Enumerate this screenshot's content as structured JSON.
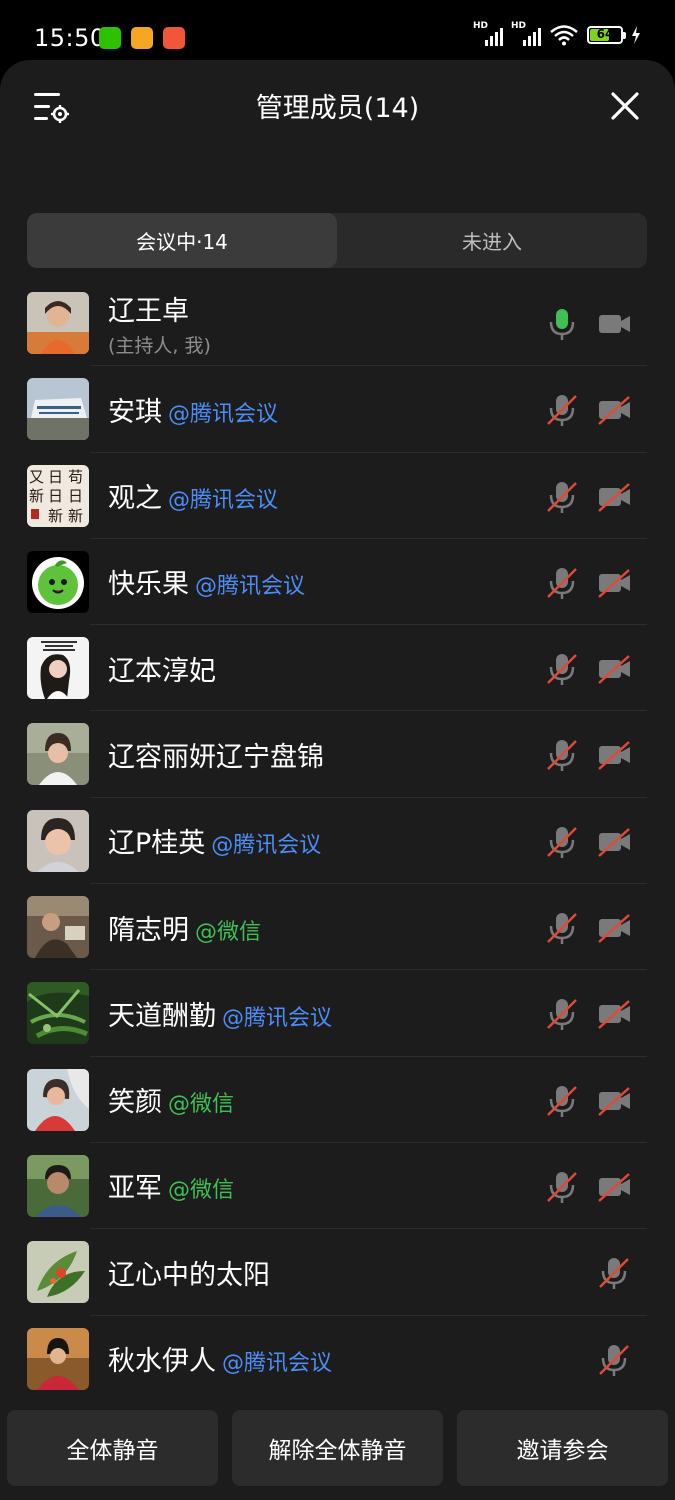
{
  "status_bar": {
    "time": "15:50",
    "battery_level": "64",
    "signal_label": "HD",
    "app_icon_colors": [
      "#2dc100",
      "#f5a623",
      "#f0563a"
    ]
  },
  "header": {
    "title": "管理成员(14)"
  },
  "tabs": [
    {
      "label": "会议中·14",
      "active": true
    },
    {
      "label": "未进入",
      "active": false
    }
  ],
  "members": [
    {
      "name": "辽王卓",
      "tag": "",
      "tag_type": "",
      "subtitle": "(主持人, 我)",
      "mic": "on",
      "camera": "off"
    },
    {
      "name": "安琪",
      "tag": "@腾讯会议",
      "tag_type": "tencent",
      "mic": "muted",
      "camera": "disabled"
    },
    {
      "name": "观之",
      "tag": "@腾讯会议",
      "tag_type": "tencent",
      "mic": "muted",
      "camera": "disabled"
    },
    {
      "name": "快乐果",
      "tag": "@腾讯会议",
      "tag_type": "tencent",
      "mic": "muted",
      "camera": "disabled"
    },
    {
      "name": "辽本淳妃",
      "tag": "",
      "tag_type": "",
      "mic": "muted",
      "camera": "disabled"
    },
    {
      "name": "辽容丽妍辽宁盘锦",
      "tag": "",
      "tag_type": "",
      "mic": "muted",
      "camera": "disabled"
    },
    {
      "name": "辽P桂英",
      "tag": "@腾讯会议",
      "tag_type": "tencent",
      "mic": "muted",
      "camera": "disabled"
    },
    {
      "name": "隋志明",
      "tag": "@微信",
      "tag_type": "wechat",
      "mic": "muted",
      "camera": "disabled"
    },
    {
      "name": "天道酬勤",
      "tag": "@腾讯会议",
      "tag_type": "tencent",
      "mic": "muted",
      "camera": "disabled"
    },
    {
      "name": "笑颜",
      "tag": "@微信",
      "tag_type": "wechat",
      "mic": "muted",
      "camera": "disabled"
    },
    {
      "name": "亚军",
      "tag": "@微信",
      "tag_type": "wechat",
      "mic": "muted",
      "camera": "disabled"
    },
    {
      "name": "辽心中的太阳",
      "tag": "",
      "tag_type": "",
      "mic": "muted",
      "camera": "none"
    },
    {
      "name": "秋水伊人",
      "tag": "@腾讯会议",
      "tag_type": "tencent",
      "mic": "muted",
      "camera": "none"
    }
  ],
  "bottom_buttons": {
    "mute_all": "全体静音",
    "unmute_all": "解除全体静音",
    "invite": "邀请参会"
  },
  "colors": {
    "tencent_tag": "#4d8df6",
    "wechat_tag": "#3fbf56",
    "mic_on": "#3fbf56",
    "muted_slash": "#e0493a",
    "sheet_bg": "#1c1c1c"
  },
  "avatar_texts": {
    "guanzhi": [
      "苟",
      "日",
      "又",
      "日",
      "日",
      "新",
      "新",
      "新"
    ]
  }
}
